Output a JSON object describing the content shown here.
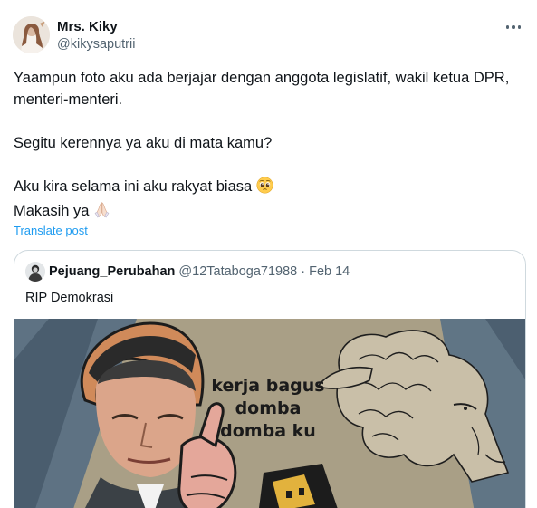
{
  "author": {
    "display_name": "Mrs. Kiky",
    "handle": "@kikysaputrii"
  },
  "tweet": {
    "line1": "Yaampun foto aku ada berjajar dengan anggota legislatif, wakil ketua DPR, menteri-menteri.",
    "line2": "Segitu kerennya ya aku di mata kamu?",
    "line3": "Aku kira selama ini aku rakyat biasa",
    "line4": "Makasih ya",
    "emoji_1": "pleading-face-emoji",
    "emoji_2": "folded-hands-emoji",
    "translate_label": "Translate post"
  },
  "quoted": {
    "display_name": "Pejuang_Perubahan",
    "handle": "@12Tataboga71988",
    "separator": "·",
    "date": "Feb 14",
    "text": "RIP Demokrasi",
    "meme_caption": "kerja bagus domba domba ku"
  },
  "colors": {
    "text": "#0f1419",
    "secondary": "#536471",
    "link": "#1d9bf0",
    "border": "#cfd9de"
  }
}
